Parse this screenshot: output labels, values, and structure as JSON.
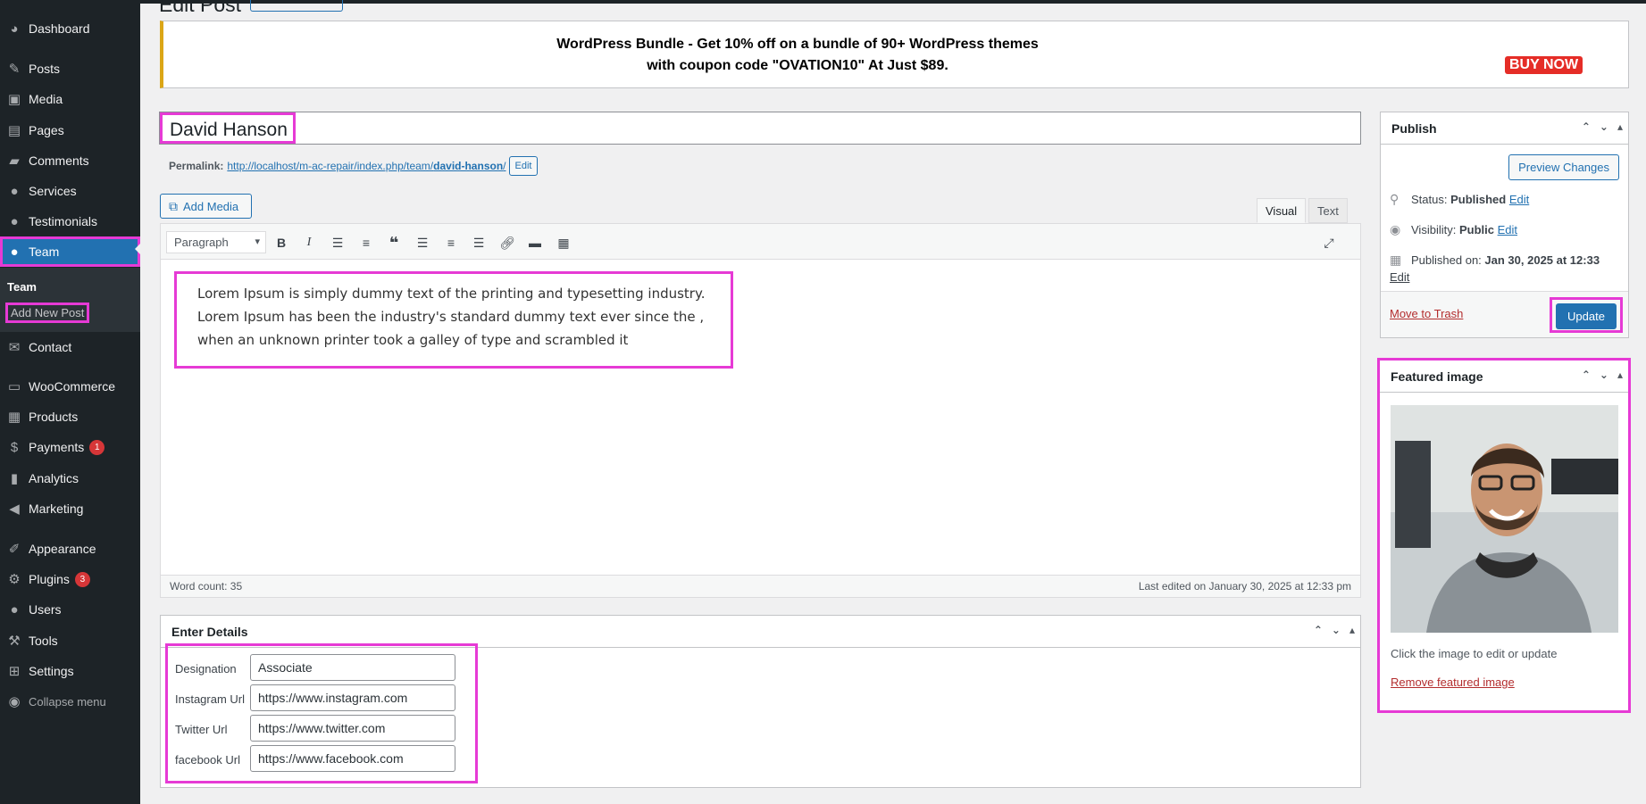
{
  "sidebar": {
    "items": [
      {
        "label": "Dashboard",
        "icon": "dashboard-icon"
      },
      {
        "label": "Posts",
        "icon": "pin-icon"
      },
      {
        "label": "Media",
        "icon": "media-icon"
      },
      {
        "label": "Pages",
        "icon": "pages-icon"
      },
      {
        "label": "Comments",
        "icon": "comment-icon"
      },
      {
        "label": "Services",
        "icon": "user-icon"
      },
      {
        "label": "Testimonials",
        "icon": "user-icon"
      },
      {
        "label": "Team",
        "icon": "user-icon"
      },
      {
        "label": "Contact",
        "icon": "mail-icon"
      },
      {
        "label": "WooCommerce",
        "icon": "woo-icon"
      },
      {
        "label": "Products",
        "icon": "archive-icon"
      },
      {
        "label": "Payments",
        "icon": "dollar-icon",
        "badge": "1"
      },
      {
        "label": "Analytics",
        "icon": "chart-icon"
      },
      {
        "label": "Marketing",
        "icon": "megaphone-icon"
      },
      {
        "label": "Appearance",
        "icon": "brush-icon"
      },
      {
        "label": "Plugins",
        "icon": "plugin-icon",
        "badge": "3"
      },
      {
        "label": "Users",
        "icon": "user-icon"
      },
      {
        "label": "Tools",
        "icon": "wrench-icon"
      },
      {
        "label": "Settings",
        "icon": "settings-icon"
      },
      {
        "label": "Collapse menu",
        "icon": "collapse-icon"
      }
    ],
    "submenu": {
      "heading": "Team",
      "link": "Add New Post"
    }
  },
  "page": {
    "title": "Edit Post"
  },
  "banner": {
    "line1": "WordPress Bundle - Get 10% off on a bundle of 90+ WordPress themes",
    "line2": "with coupon code \"OVATION10\" At Just $89.",
    "cta": "BUY NOW"
  },
  "post": {
    "title": "David Hanson",
    "permalink_label": "Permalink:",
    "permalink_base": "http://localhost/m-ac-repair/index.php/team/",
    "permalink_slug": "david-hanson",
    "permalink_end": "/",
    "permalink_edit": "Edit"
  },
  "editor": {
    "add_media": "Add Media",
    "tab_visual": "Visual",
    "tab_text": "Text",
    "format": "Paragraph",
    "content": "Lorem Ipsum is simply dummy text of the printing and typesetting industry. Lorem Ipsum has been the industry's standard dummy text ever since the , when an unknown printer took a galley of type and scrambled it",
    "word_count": "Word count: 35",
    "last_edited": "Last edited on January 30, 2025 at 12:33 pm"
  },
  "details": {
    "heading": "Enter Details",
    "fields": [
      {
        "label": "Designation",
        "value": "Associate"
      },
      {
        "label": "Instagram Url",
        "value": "https://www.instagram.com"
      },
      {
        "label": "Twitter Url",
        "value": "https://www.twitter.com"
      },
      {
        "label": "facebook Url",
        "value": "https://www.facebook.com"
      }
    ]
  },
  "publish": {
    "heading": "Publish",
    "preview": "Preview Changes",
    "status_label": "Status:",
    "status_value": "Published",
    "visibility_label": "Visibility:",
    "visibility_value": "Public",
    "published_label": "Published on:",
    "published_value": "Jan 30, 2025 at 12:33",
    "edit": "Edit",
    "trash": "Move to Trash",
    "update": "Update"
  },
  "featured": {
    "heading": "Featured image",
    "note": "Click the image to edit or update",
    "remove": "Remove featured image"
  },
  "colors": {
    "accent": "#2271b1",
    "highlight": "#e63ad5",
    "sidebar": "#1d2327",
    "danger": "#b32d2e"
  }
}
